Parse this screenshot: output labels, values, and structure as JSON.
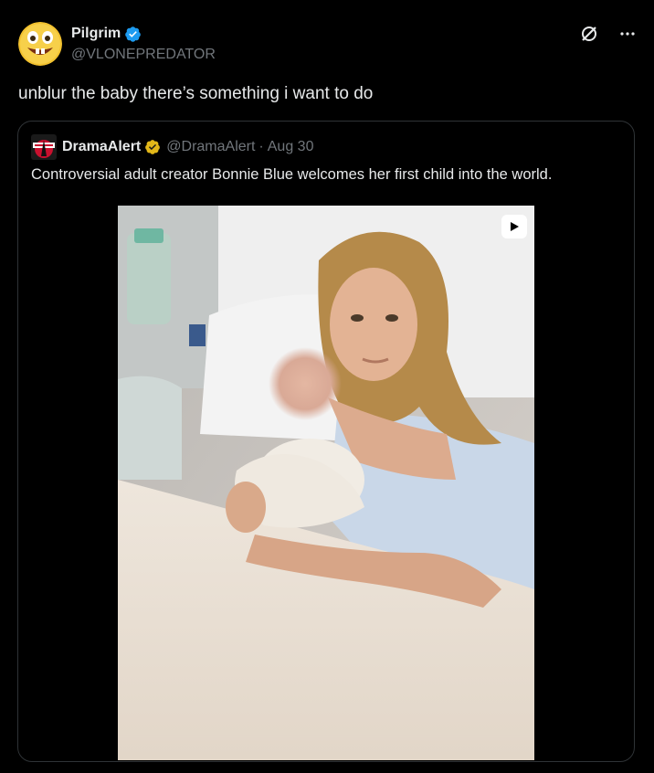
{
  "post": {
    "display_name": "Pilgrim",
    "handle": "@VLONEPREDATOR",
    "text": "unblur the baby there’s something i want to do",
    "icons": {
      "avatar": "grinning-emoji-avatar",
      "verified": "verified-badge-icon",
      "grok": "grok-icon",
      "more": "more-options-icon"
    },
    "colors": {
      "verified": "#1d9bf0"
    }
  },
  "quote": {
    "display_name": "DramaAlert",
    "handle": "@DramaAlert",
    "separator": "·",
    "date": "Aug 30",
    "text": "Controversial adult creator Bonnie Blue welcomes her first child into the world.",
    "icons": {
      "avatar": "dramaalert-logo",
      "verified": "gold-verified-badge-icon",
      "media": "play-icon"
    },
    "colors": {
      "verified": "#e2b719"
    }
  }
}
